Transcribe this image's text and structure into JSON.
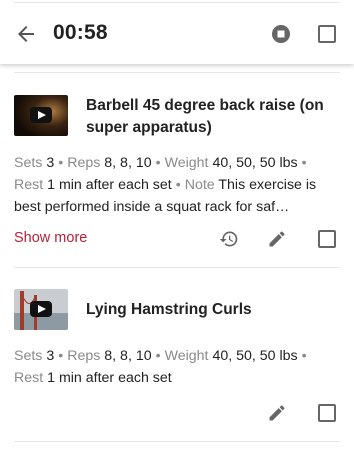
{
  "header": {
    "timer": "00:58",
    "icons": {
      "back": "back-arrow-icon",
      "stop": "stop-icon"
    }
  },
  "exercises": [
    {
      "title": "Barbell 45 degree back raise (on super apparatus)",
      "sets_label": "Sets",
      "sets": "3",
      "reps_label": "Reps",
      "reps": "8, 8, 10",
      "weight_label": "Weight",
      "weight": "40, 50, 50 lbs",
      "rest_label": "Rest",
      "rest": "1 min after each set",
      "note_label": "Note",
      "note": "This exercise is best performed inside a squat rack for saf…",
      "show_more": "Show more"
    },
    {
      "title": "Lying Hamstring Curls",
      "sets_label": "Sets",
      "sets": "3",
      "reps_label": "Reps",
      "reps": "8, 8, 10",
      "weight_label": "Weight",
      "weight": "40, 50, 50 lbs",
      "rest_label": "Rest",
      "rest": "1 min after each set"
    }
  ],
  "separator": "•",
  "colors": {
    "accent": "#b0243a",
    "label": "#8a8a8a",
    "icon": "#666666"
  }
}
